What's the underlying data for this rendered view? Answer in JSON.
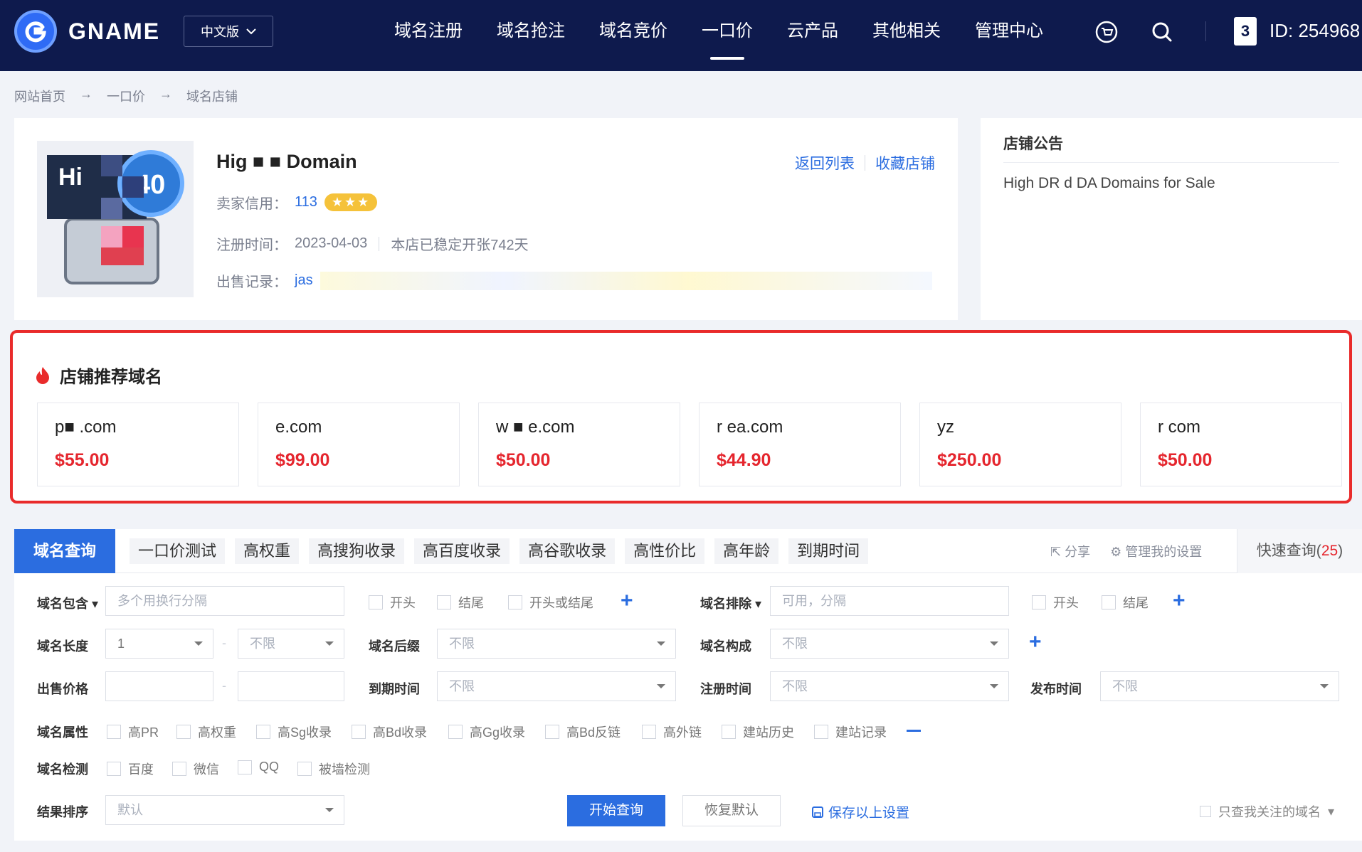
{
  "header": {
    "logo_text": "GNAME",
    "lang": "中文版",
    "nav": [
      "域名注册",
      "域名抢注",
      "域名竞价",
      "一口价",
      "云产品",
      "其他相关",
      "管理中心"
    ],
    "active_nav": "一口价",
    "user_badge": "3",
    "user_id": "ID: 254968"
  },
  "breadcrumb": [
    "网站首页",
    "→",
    "一口价",
    "→",
    "域名店铺"
  ],
  "shop": {
    "name": "Hig ■ ■ Domain",
    "back_link": "返回列表",
    "fav_link": "收藏店铺",
    "credit_label": "卖家信用：",
    "credit_value": "113",
    "stars": "★★★",
    "reg_label": "注册时间：",
    "reg_date": "2023-04-03",
    "open_days": "本店已稳定开张742天",
    "sales_label": "出售记录：",
    "sales_value": "jas"
  },
  "notice": {
    "title": "店铺公告",
    "body": "High DR d DA Domains for Sale"
  },
  "recommend": {
    "title": "店铺推荐域名",
    "items": [
      {
        "domain": "p■ .com",
        "price": "$55.00"
      },
      {
        "domain": "e.com",
        "price": "$99.00"
      },
      {
        "domain": "w ■ e.com",
        "price": "$50.00"
      },
      {
        "domain": "r ea.com",
        "price": "$44.90"
      },
      {
        "domain": "yz",
        "price": "$250.00"
      },
      {
        "domain": "r com",
        "price": "$50.00"
      }
    ]
  },
  "search": {
    "active_tab": "域名查询",
    "tabs": [
      "一口价测试",
      "高权重",
      "高搜狗收录",
      "高百度收录",
      "高谷歌收录",
      "高性价比",
      "高年龄",
      "到期时间"
    ],
    "share": "分享",
    "manage": "管理我的设置",
    "quick_label": "快速查询(",
    "quick_count": "25",
    "quick_end": ")",
    "contains_label": "域名包含",
    "contains_placeholder": "多个用换行分隔",
    "chk_start": "开头",
    "chk_end": "结尾",
    "chk_start_or_end": "开头或结尾",
    "exclude_label": "域名排除",
    "exclude_placeholder": "可用，分隔",
    "length_label": "域名长度",
    "length_min": "1",
    "unlimited": "不限",
    "suffix_label": "域名后缀",
    "compose_label": "域名构成",
    "price_label": "出售价格",
    "expire_label": "到期时间",
    "reg_label": "注册时间",
    "publish_label": "发布时间",
    "attr_label": "域名属性",
    "attrs": [
      "高PR",
      "高权重",
      "高Sg收录",
      "高Bd收录",
      "高Gg收录",
      "高Bd反链",
      "高外链",
      "建站历史",
      "建站记录"
    ],
    "check_label": "域名检测",
    "checks": [
      "百度",
      "微信",
      "QQ",
      "被墙检测"
    ],
    "sort_label": "结果排序",
    "sort_value": "默认",
    "btn_search": "开始查询",
    "btn_reset": "恢复默认",
    "save_settings": "保存以上设置",
    "follow_only": "只查我关注的域名"
  }
}
